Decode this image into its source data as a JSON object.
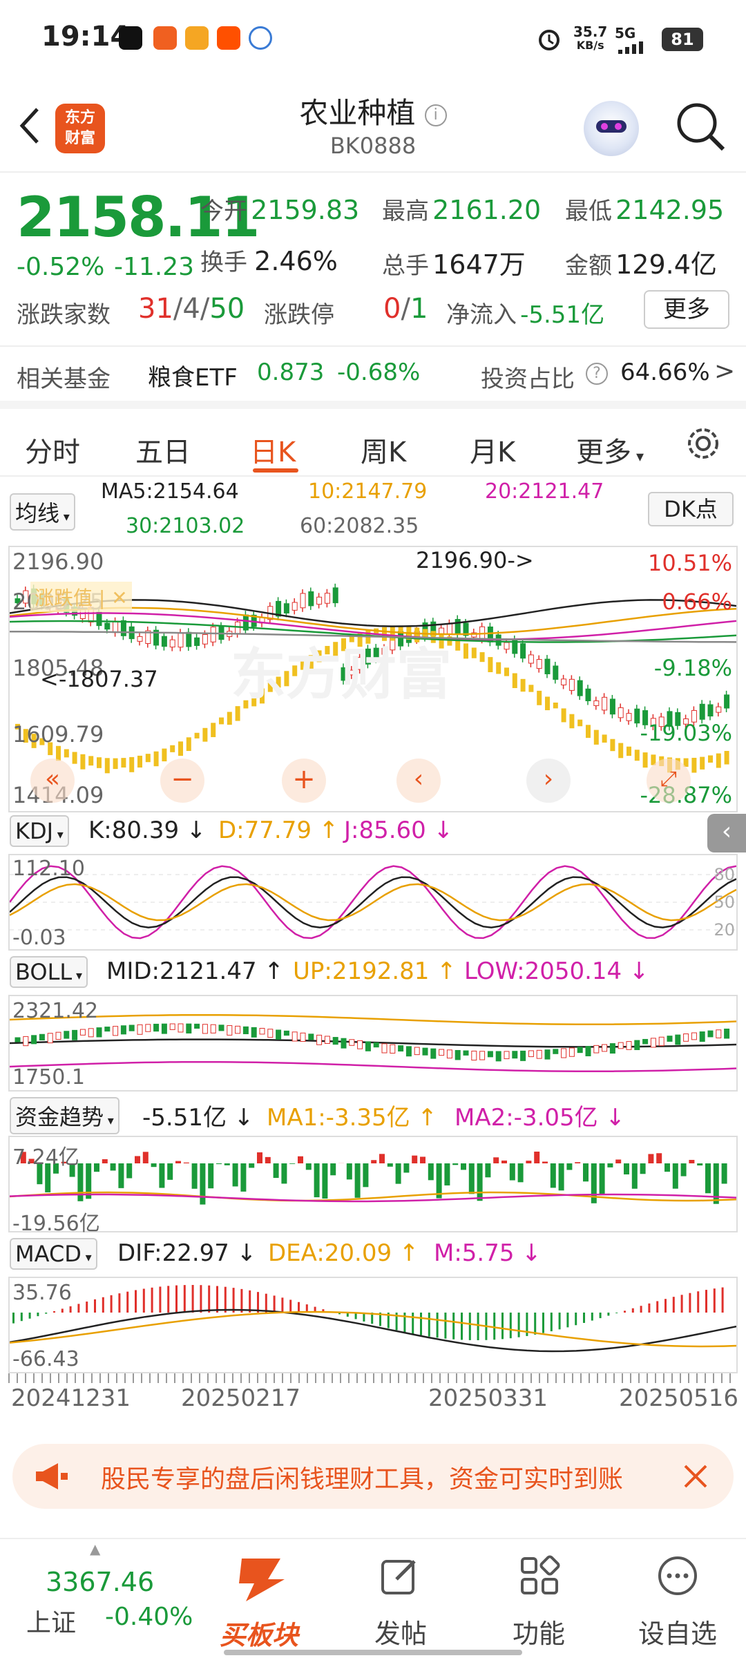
{
  "status_bar": {
    "time": "19:14",
    "net_speed": "35.7",
    "net_unit": "KB/s",
    "network": "5G",
    "battery": "81"
  },
  "header": {
    "logo_line1": "东方",
    "logo_line2": "财富",
    "title": "农业种植",
    "code": "BK0888"
  },
  "quote": {
    "price": "2158.11",
    "change_pct": "-0.52%",
    "change": "-11.23",
    "open_label": "今开",
    "open": "2159.83",
    "high_label": "最高",
    "high": "2161.20",
    "low_label": "最低",
    "low": "2142.95",
    "turnover_label": "换手",
    "turnover": "2.46%",
    "volume_label": "总手",
    "volume": "1647万",
    "amount_label": "金额",
    "amount": "129.4亿",
    "updown_label": "涨跌家数",
    "up": "31",
    "flat": "4",
    "down": "50",
    "limit_label": "涨跌停",
    "limit_up": "0",
    "limit_down": "1",
    "inflow_label": "净流入",
    "inflow": "-5.51亿",
    "more": "更多"
  },
  "fund": {
    "label": "相关基金",
    "name": "粮食ETF",
    "price": "0.873",
    "pct": "-0.68%",
    "ratio_label": "投资占比",
    "ratio": "64.66%"
  },
  "tabs": [
    "分时",
    "五日",
    "日K",
    "周K",
    "月K",
    "更多"
  ],
  "ma": {
    "selector": "均线",
    "ma5": "MA5:2154.64",
    "ma10": "10:2147.79",
    "ma20": "20:2121.47",
    "ma30": "30:2103.02",
    "ma60": "60:2082.35",
    "dk": "DK点"
  },
  "main_chart": {
    "y_labels": [
      "2196.90",
      "2005.25",
      "1805.48",
      "1609.79",
      "1414.09"
    ],
    "pct_labels": [
      "10.51%",
      "0.66%",
      "-9.18%",
      "-19.03%",
      "-28.87%"
    ],
    "max_mark": "2196.90->",
    "min_mark": "<-1807.37",
    "watermark": "东方财富",
    "tag": "涨跌值"
  },
  "kdj": {
    "selector": "KDJ",
    "k": "K:80.39",
    "d": "D:77.79",
    "j": "J:85.60",
    "y_top": "112.10",
    "y_bottom": "-0.03",
    "levels": [
      "80",
      "50",
      "20"
    ]
  },
  "boll": {
    "selector": "BOLL",
    "mid": "MID:2121.47",
    "up": "UP:2192.81",
    "low": "LOW:2050.14",
    "y_top": "2321.42",
    "y_bottom": "1750.1"
  },
  "fundflow": {
    "selector": "资金趋势",
    "value": "-5.51亿",
    "ma1": "MA1:-3.35亿",
    "ma2": "MA2:-3.05亿",
    "y_top": "7.24亿",
    "y_bottom": "-19.56亿"
  },
  "macd": {
    "selector": "MACD",
    "dif": "DIF:22.97",
    "dea": "DEA:20.09",
    "m": "M:5.75",
    "y_top": "35.76",
    "y_bottom": "-66.43"
  },
  "dates": [
    "20241231",
    "20250217",
    "20250331",
    "20250516"
  ],
  "ad": {
    "text": "股民专享的盘后闲钱理财工具，资金可实时到账"
  },
  "bottom": {
    "index_value": "3367.46",
    "index_name": "上证",
    "index_pct": "-0.40%",
    "buy_block": "买板块",
    "post": "发帖",
    "func": "功能",
    "watch": "设自选"
  }
}
